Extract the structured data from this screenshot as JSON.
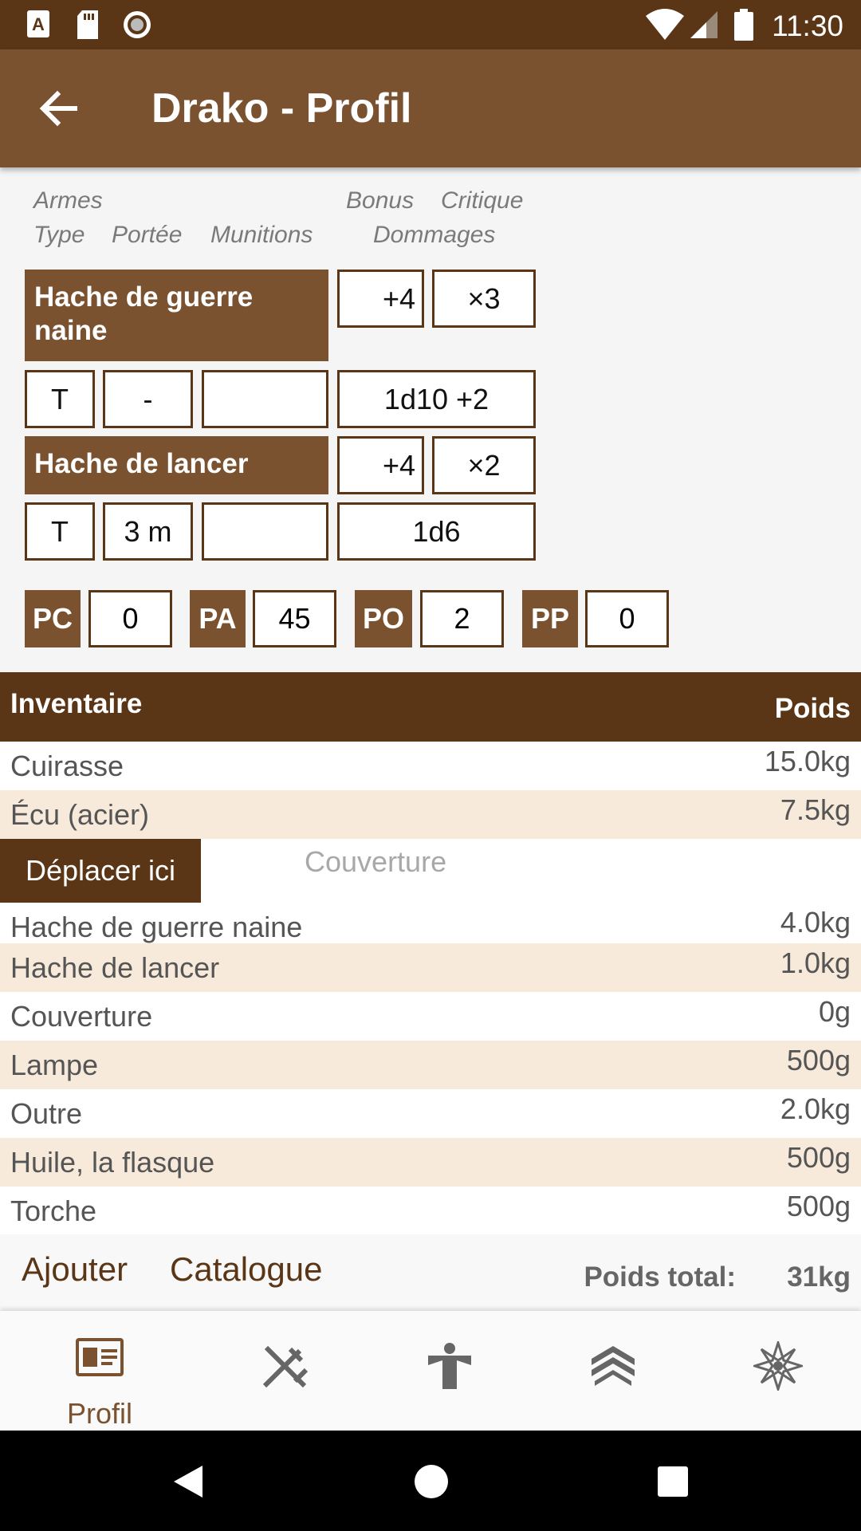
{
  "status_bar": {
    "time": "11:30"
  },
  "app_bar": {
    "title": "Drako - Profil"
  },
  "weapons": {
    "headers": {
      "armes": "Armes",
      "type": "Type",
      "portee": "Portée",
      "munitions": "Munitions",
      "bonus": "Bonus",
      "critique": "Critique",
      "dommages": "Dommages"
    },
    "items": [
      {
        "name": "Hache de guerre naine",
        "bonus": "+4",
        "critique": "×3",
        "type": "T",
        "portee": "-",
        "munitions": "",
        "dommages": "1d10 +2"
      },
      {
        "name": "Hache de lancer",
        "bonus": "+4",
        "critique": "×2",
        "type": "T",
        "portee": "3 m",
        "munitions": "",
        "dommages": "1d6"
      }
    ]
  },
  "money": [
    {
      "label": "PC",
      "value": "0"
    },
    {
      "label": "PA",
      "value": "45"
    },
    {
      "label": "PO",
      "value": "2"
    },
    {
      "label": "PP",
      "value": "0"
    }
  ],
  "inventory": {
    "title": "Inventaire",
    "weight_header": "Poids",
    "items_top": [
      {
        "name": "Cuirasse",
        "weight": "15.0kg"
      },
      {
        "name": "Écu (acier)",
        "weight": "7.5kg"
      }
    ],
    "move_here_label": "Déplacer ici",
    "dragging_item": "Couverture",
    "items_bottom": [
      {
        "name": "Hache de guerre naine",
        "weight": "4.0kg"
      },
      {
        "name": "Hache de lancer",
        "weight": "1.0kg"
      },
      {
        "name": "Couverture",
        "weight": "0g"
      },
      {
        "name": "Lampe",
        "weight": "500g"
      },
      {
        "name": "Outre",
        "weight": "2.0kg"
      },
      {
        "name": "Huile, la flasque",
        "weight": "500g"
      },
      {
        "name": "Torche",
        "weight": "500g"
      }
    ],
    "add_label": "Ajouter",
    "catalog_label": "Catalogue",
    "total_label": "Poids total:",
    "total_value": "31kg"
  },
  "bottom_nav": {
    "items": [
      {
        "icon": "profile-card-icon",
        "label": "Profil",
        "active": true
      },
      {
        "icon": "crossed-weapons-icon",
        "label": ""
      },
      {
        "icon": "strength-figure-icon",
        "label": ""
      },
      {
        "icon": "rank-chevrons-icon",
        "label": ""
      },
      {
        "icon": "magic-star-icon",
        "label": ""
      }
    ],
    "active_color": "#7a5230",
    "inactive_color": "#666666"
  },
  "colors": {
    "status_bar": "#5a3616",
    "app_bar": "#7a5230",
    "accent_dark": "#5a3616",
    "row_alt": "#f7eadb"
  }
}
